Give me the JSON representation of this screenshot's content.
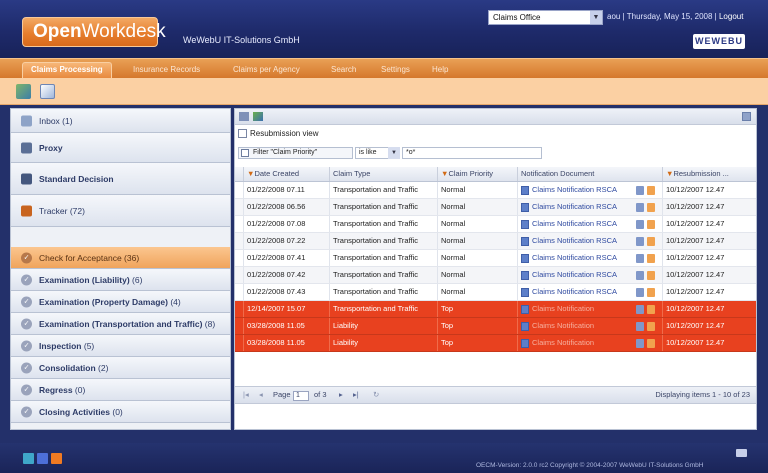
{
  "header": {
    "logo_bold": "Open",
    "logo_light": "Workdesk",
    "company": "WeWebU IT-Solutions GmbH",
    "office_select": "Claims Office",
    "user": "aou",
    "separator1": " | ",
    "date": "Thursday, May 15, 2008",
    "separator2": " | ",
    "logout": "Logout",
    "brand": "WEWEBU"
  },
  "nav": {
    "tabs": [
      "Claims Processing",
      "Insurance Records",
      "Claims per Agency",
      "Search",
      "Settings",
      "Help"
    ]
  },
  "sidebar": {
    "items": [
      {
        "label": "Inbox (1)",
        "bold": false
      },
      {
        "label": "Proxy",
        "bold": true
      },
      {
        "label": "Standard Decision",
        "bold": true
      },
      {
        "label": "Tracker (72)",
        "bold": false
      }
    ],
    "tasks": [
      {
        "label": "Check for Acceptance",
        "count": " (36)"
      },
      {
        "label": "Examination (Liability)",
        "count": " (6)"
      },
      {
        "label": "Examination (Property Damage)",
        "count": " (4)"
      },
      {
        "label": "Examination (Transportation and Traffic)",
        "count": " (8)"
      },
      {
        "label": "Inspection",
        "count": " (5)"
      },
      {
        "label": "Consolidation",
        "count": " (2)"
      },
      {
        "label": "Regress",
        "count": " (0)"
      },
      {
        "label": "Closing Activities",
        "count": " (0)"
      }
    ]
  },
  "main": {
    "resubmission_label": "Resubmission view",
    "filter_label": "Filter \"Claim Priority\"",
    "filter_op": "is like",
    "filter_value": "*o*",
    "columns": [
      "Date Created",
      "Claim Type",
      "Claim Priority",
      "Notification Document",
      "Resubmission ..."
    ],
    "rows": [
      {
        "date": "01/22/2008 07.11",
        "type": "Transportation and Traffic",
        "priority": "Normal",
        "doc": "Claims Notification RSCA",
        "resub": "10/12/2007 12.47",
        "style": "normal"
      },
      {
        "date": "01/22/2008 06.56",
        "type": "Transportation and Traffic",
        "priority": "Normal",
        "doc": "Claims Notification RSCA",
        "resub": "10/12/2007 12.47",
        "style": "alt"
      },
      {
        "date": "01/22/2008 07.08",
        "type": "Transportation and Traffic",
        "priority": "Normal",
        "doc": "Claims Notification RSCA",
        "resub": "10/12/2007 12.47",
        "style": "normal"
      },
      {
        "date": "01/22/2008 07.22",
        "type": "Transportation and Traffic",
        "priority": "Normal",
        "doc": "Claims Notification RSCA",
        "resub": "10/12/2007 12.47",
        "style": "alt"
      },
      {
        "date": "01/22/2008 07.41",
        "type": "Transportation and Traffic",
        "priority": "Normal",
        "doc": "Claims Notification RSCA",
        "resub": "10/12/2007 12.47",
        "style": "normal"
      },
      {
        "date": "01/22/2008 07.42",
        "type": "Transportation and Traffic",
        "priority": "Normal",
        "doc": "Claims Notification RSCA",
        "resub": "10/12/2007 12.47",
        "style": "alt"
      },
      {
        "date": "01/22/2008 07.43",
        "type": "Transportation and Traffic",
        "priority": "Normal",
        "doc": "Claims Notification RSCA",
        "resub": "10/12/2007 12.47",
        "style": "normal"
      },
      {
        "date": "12/14/2007 15.07",
        "type": "Transportation and Traffic",
        "priority": "Top",
        "doc": "Claims Notification",
        "resub": "10/12/2007 12.47",
        "style": "top"
      },
      {
        "date": "03/28/2008 11.05",
        "type": "Liability",
        "priority": "Top",
        "doc": "Claims Notification",
        "resub": "10/12/2007 12.47",
        "style": "top"
      },
      {
        "date": "03/28/2008 11.05",
        "type": "Liability",
        "priority": "Top",
        "doc": "Claims Notification",
        "resub": "10/12/2007 12.47",
        "style": "top"
      }
    ],
    "pager": {
      "page_label": "Page",
      "page_value": "1",
      "of_label": "of 3",
      "display": "Displaying items 1 - 10 of 23"
    }
  },
  "footer": {
    "copyright": "OECM-Version: 2.0.0 rc2 Copyright © 2004-2007 WeWebU IT-Solutions GmbH"
  },
  "colors": {
    "accent": "#e67e2e",
    "header_bg": "#1e2a6a",
    "highlight_row": "#e8411f"
  }
}
